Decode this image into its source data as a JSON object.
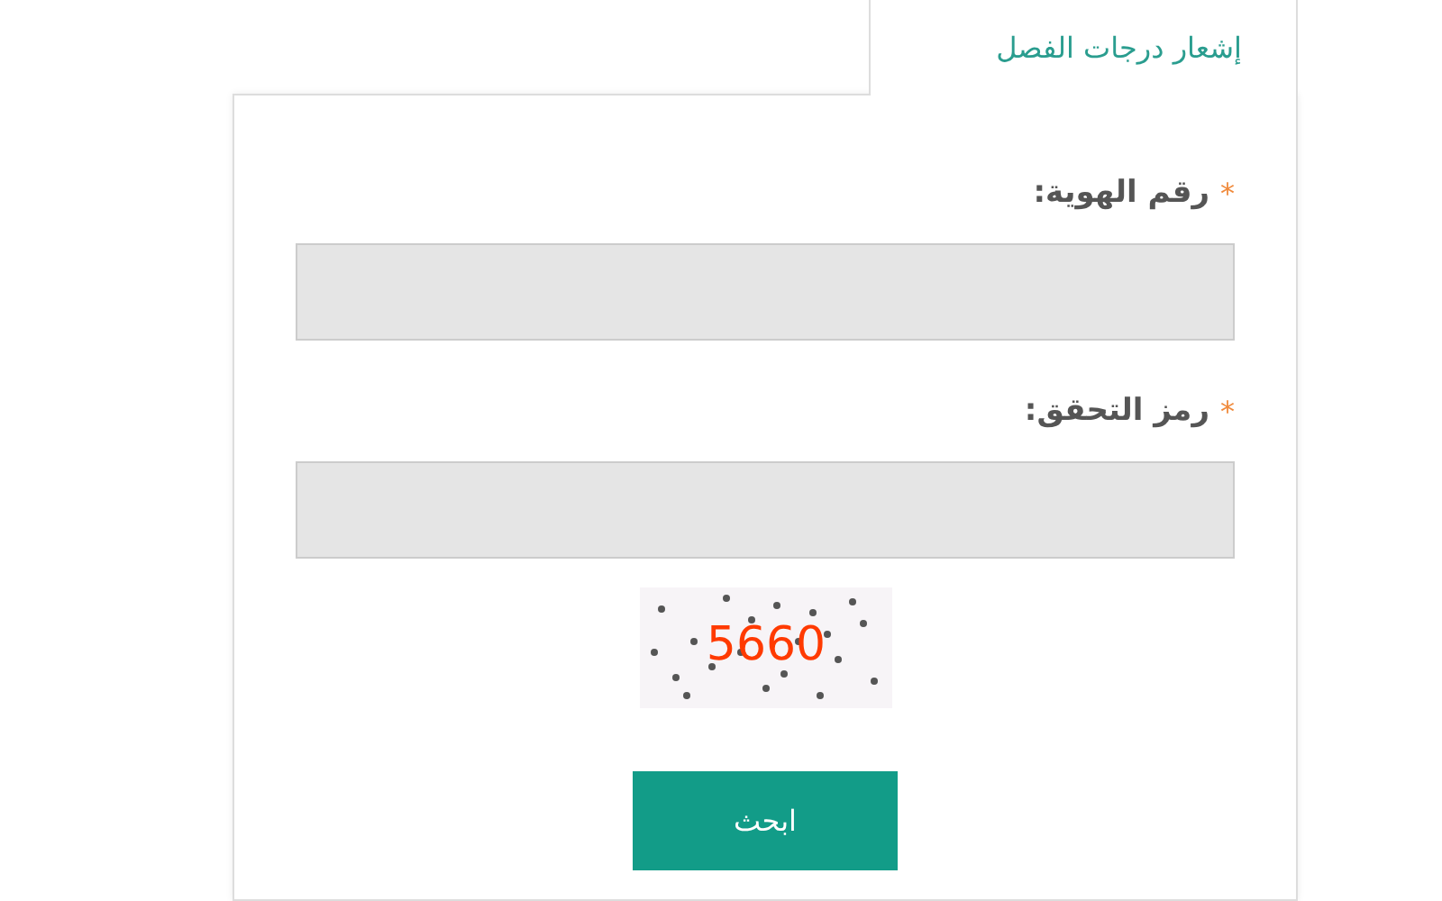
{
  "tab": {
    "label": "إشعار درجات الفصل"
  },
  "fields": [
    {
      "label": "رقم الهوية:",
      "required_mark": "*"
    },
    {
      "label": "رمز التحقق:",
      "required_mark": "*"
    }
  ],
  "captcha": {
    "code": "5660"
  },
  "submit_button": "ابحث"
}
